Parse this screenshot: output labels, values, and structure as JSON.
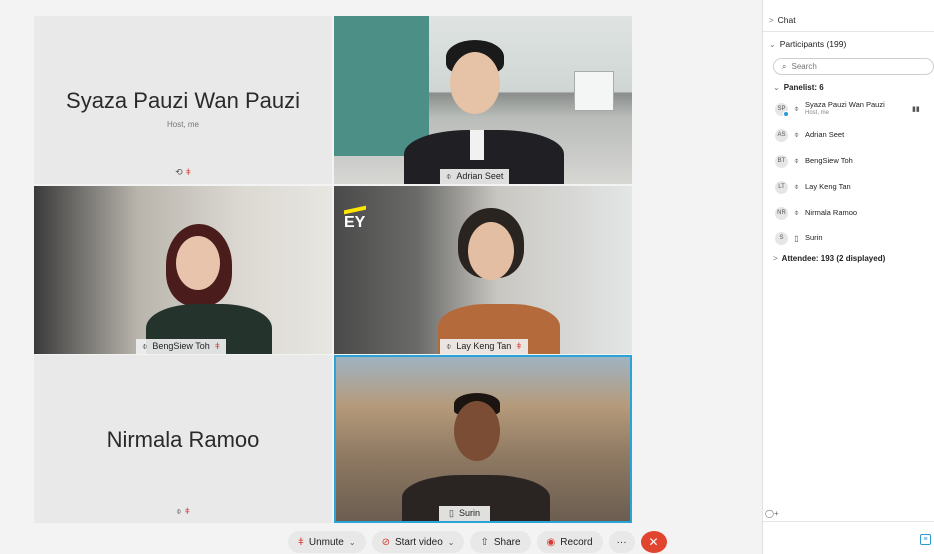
{
  "tiles": {
    "host": {
      "name": "Syaza Pauzi Wan Pauzi",
      "role": "Host, me"
    },
    "adrian": {
      "name": "Adrian Seet"
    },
    "bengsiew": {
      "name": "BengSiew Toh"
    },
    "laykeng": {
      "name": "Lay Keng Tan",
      "logo": "EY"
    },
    "nirmala": {
      "name": "Nirmala Ramoo"
    },
    "surin": {
      "name": "Surin"
    }
  },
  "toolbar": {
    "unmute": "Unmute",
    "start_video": "Start video",
    "share": "Share",
    "record": "Record",
    "more": "···",
    "end": "✕"
  },
  "panel": {
    "chat": "Chat",
    "participants": "Participants (199)",
    "search_placeholder": "Search",
    "panelist_header": "Panelist: 6",
    "panelists": [
      {
        "initials": "SP",
        "name": "Syaza Pauzi Wan Pauzi",
        "sub": "Host, me"
      },
      {
        "initials": "AS",
        "name": "Adrian Seet"
      },
      {
        "initials": "BT",
        "name": "BengSiew Toh"
      },
      {
        "initials": "LT",
        "name": "Lay Keng Tan"
      },
      {
        "initials": "NR",
        "name": "Nirmala Ramoo"
      },
      {
        "initials": "S",
        "name": "Surin"
      }
    ],
    "attendee_header": "Attendee: 193 (2 displayed)"
  },
  "colors": {
    "accent": "#2aa4d6",
    "muted": "#d23b2f",
    "end_call": "#e2452f"
  },
  "icons": {
    "mic": "mic-icon",
    "mic_muted": "mic-muted-icon",
    "video": "video-off-icon",
    "share": "share-icon",
    "record": "record-icon",
    "phone": "phone-icon",
    "search": "search-icon"
  }
}
